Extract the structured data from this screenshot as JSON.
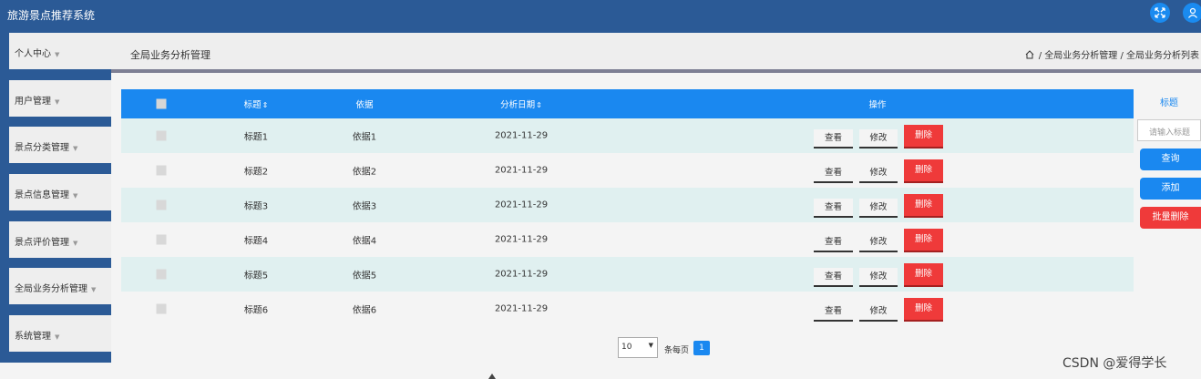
{
  "app": {
    "title": "旅游景点推荐系统"
  },
  "topbar": {
    "fullscreen_icon": "expand-icon",
    "user_icon": "user-icon"
  },
  "sidebar": {
    "items": [
      {
        "label": "个人中心"
      },
      {
        "label": "用户管理"
      },
      {
        "label": "景点分类管理"
      },
      {
        "label": "景点信息管理"
      },
      {
        "label": "景点评价管理"
      },
      {
        "label": "全局业务分析管理"
      },
      {
        "label": "系统管理"
      }
    ]
  },
  "header": {
    "title": "全局业务分析管理",
    "breadcrumb": [
      "全局业务分析管理",
      "全局业务分析列表"
    ]
  },
  "table": {
    "columns": {
      "title": "标题",
      "basis": "依据",
      "date": "分析日期",
      "actions": "操作"
    },
    "rows": [
      {
        "title": "标题1",
        "basis": "依据1",
        "date": "2021-11-29"
      },
      {
        "title": "标题2",
        "basis": "依据2",
        "date": "2021-11-29"
      },
      {
        "title": "标题3",
        "basis": "依据3",
        "date": "2021-11-29"
      },
      {
        "title": "标题4",
        "basis": "依据4",
        "date": "2021-11-29"
      },
      {
        "title": "标题5",
        "basis": "依据5",
        "date": "2021-11-29"
      },
      {
        "title": "标题6",
        "basis": "依据6",
        "date": "2021-11-29"
      }
    ],
    "actions": {
      "view": "查看",
      "edit": "修改",
      "delete": "删除"
    }
  },
  "pagination": {
    "page_size": "10",
    "per_page_label": "条每页",
    "current_page": "1"
  },
  "search": {
    "label": "标题",
    "placeholder": "请输入标题",
    "query_button": "查询",
    "add_button": "添加",
    "batch_delete_button": "批量删除"
  },
  "watermark": "CSDN @爱得学长",
  "colors": {
    "primary": "#1a88f0",
    "nav": "#2b5a96",
    "danger": "#ef3a3a",
    "row_alt": "#e0f0f0"
  }
}
